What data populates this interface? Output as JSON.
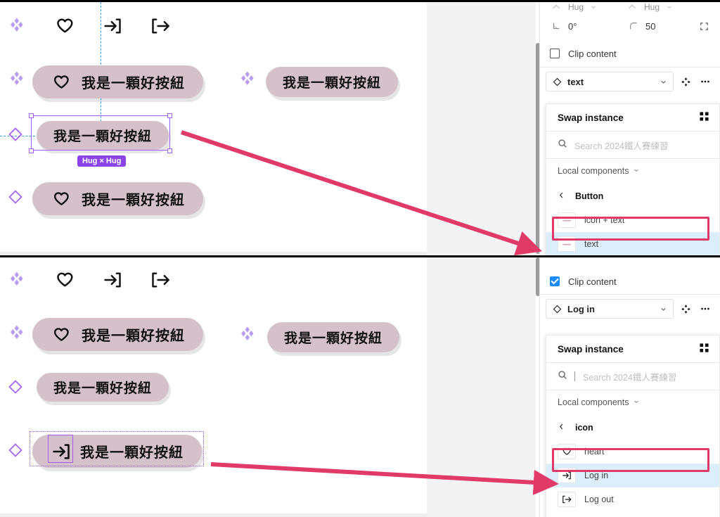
{
  "top_shot": {
    "canvas": {
      "icons_row": [
        {
          "name": "sparkle-icon"
        },
        {
          "name": "heart-icon"
        },
        {
          "name": "log-in-icon"
        },
        {
          "name": "log-out-icon"
        }
      ],
      "buttons": [
        {
          "label": "我是一顆好按紐",
          "icon": "heart-icon",
          "state": "normal"
        },
        {
          "label": "我是一顆好按紐",
          "icon": "none",
          "state": "normal"
        },
        {
          "label": "我是一顆好按紐",
          "icon": "none",
          "state": "selected"
        },
        {
          "label": "我是一顆好按紐",
          "icon": "heart-icon",
          "state": "normal"
        }
      ],
      "selection_badge": "Hug × Hug"
    },
    "panel": {
      "rotation_label": "0°",
      "corner_radius_label": "50",
      "clip_content_label": "Clip content",
      "clip_content_checked": false,
      "instance_name": "text",
      "popover": {
        "title": "Swap instance",
        "search_placeholder": "Search 2024鐵人賽練習",
        "group_label": "Local components",
        "back_label": "Button",
        "items": [
          {
            "label": "icon + text",
            "selected": false
          },
          {
            "label": "text",
            "selected": true
          }
        ]
      }
    }
  },
  "bottom_shot": {
    "canvas": {
      "icons_row": [
        {
          "name": "sparkle-icon"
        },
        {
          "name": "heart-icon"
        },
        {
          "name": "log-in-icon"
        },
        {
          "name": "log-out-icon"
        }
      ],
      "buttons": [
        {
          "label": "我是一顆好按紐",
          "icon": "heart-icon",
          "state": "normal"
        },
        {
          "label": "我是一顆好按紐",
          "icon": "none",
          "state": "normal"
        },
        {
          "label": "我是一顆好按紐",
          "icon": "none",
          "state": "normal"
        },
        {
          "label": "我是一顆好按紐",
          "icon": "log-in-icon",
          "state": "selected"
        }
      ]
    },
    "panel": {
      "clip_content_label": "Clip content",
      "clip_content_checked": true,
      "instance_name": "Log in",
      "popover": {
        "title": "Swap instance",
        "search_placeholder": "Search 2024鐵人賽練習",
        "group_label": "Local components",
        "back_label": "icon",
        "items": [
          {
            "label": "heart",
            "icon": "heart-icon",
            "selected": false
          },
          {
            "label": "Log in",
            "icon": "log-in-icon",
            "selected": true
          },
          {
            "label": "Log out",
            "icon": "log-out-icon",
            "selected": false
          }
        ]
      }
    }
  },
  "colors": {
    "button_fill": "#d5c1c9",
    "selection": "#a259ff",
    "annotation": "#e23a68",
    "highlight_row": "#dceefc",
    "checkbox_on": "#1a8cff"
  }
}
